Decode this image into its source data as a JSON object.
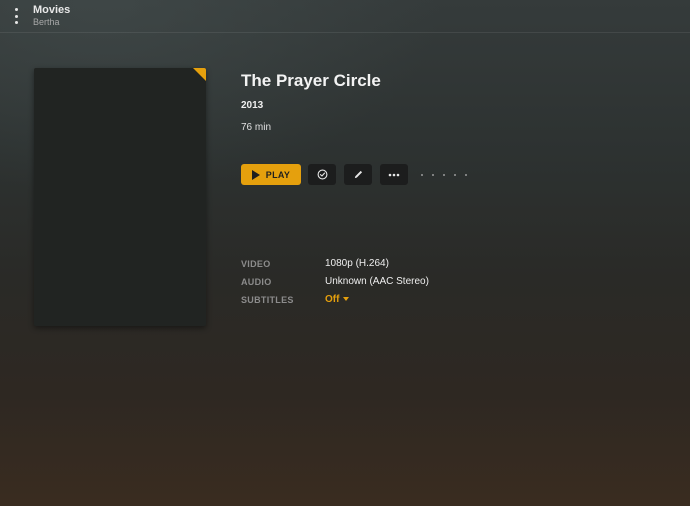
{
  "header": {
    "section_title": "Movies",
    "server_name": "Bertha"
  },
  "movie": {
    "title": "The Prayer Circle",
    "year": "2013",
    "duration": "76 min"
  },
  "actions": {
    "play_label": "PLAY",
    "mark_watched_icon": "check-circle-icon",
    "edit_icon": "pencil-icon",
    "more_icon": "more-horizontal-icon"
  },
  "media_info": {
    "video_label": "VIDEO",
    "video_value": "1080p (H.264)",
    "audio_label": "AUDIO",
    "audio_value": "Unknown (AAC Stereo)",
    "subtitles_label": "SUBTITLES",
    "subtitles_value": "Off"
  },
  "colors": {
    "accent": "#e5a00d",
    "button_dark": "#1c1d1d"
  }
}
